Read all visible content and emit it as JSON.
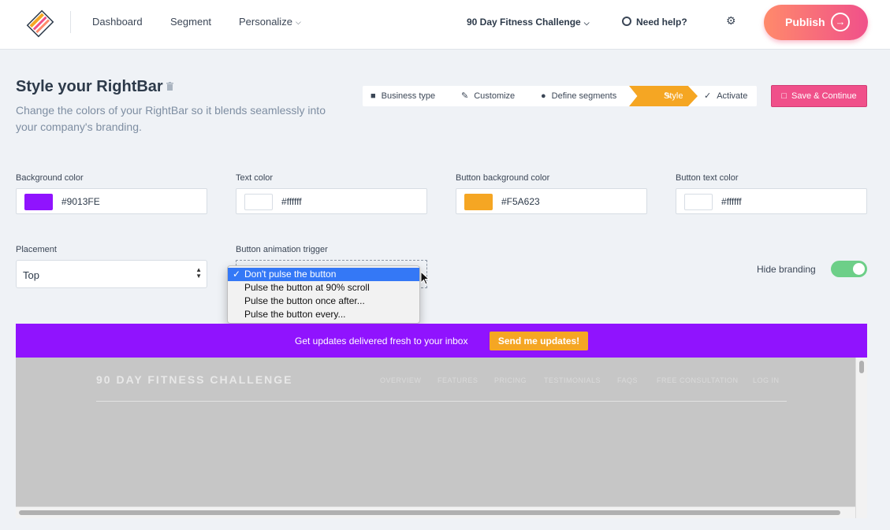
{
  "nav": {
    "links": [
      "Dashboard",
      "Segment",
      "Personalize"
    ],
    "personalize_chevron": "chevron-down-icon",
    "project": "90 Day Fitness Challenge",
    "help": "Need help?",
    "publish": "Publish"
  },
  "header": {
    "title": "Style your RightBar",
    "subtitle": "Change the colors of your RightBar so it blends seamlessly into your company's branding."
  },
  "stepper": {
    "steps": [
      "Business type",
      "Customize",
      "Define segments",
      "Style",
      "Activate"
    ],
    "active": "Style",
    "save": "Save & Continue"
  },
  "colors": [
    {
      "label": "Background color",
      "value": "#9013FE",
      "swatch": "#9013FE"
    },
    {
      "label": "Text color",
      "value": "#ffffff",
      "swatch": "#ffffff"
    },
    {
      "label": "Button background color",
      "value": "#F5A623",
      "swatch": "#F5A623"
    },
    {
      "label": "Button text color",
      "value": "#ffffff",
      "swatch": "#ffffff"
    }
  ],
  "placement": {
    "label": "Placement",
    "value": "Top"
  },
  "animation": {
    "label": "Button animation trigger",
    "options": [
      "Don't pulse the button",
      "Pulse the button at 90% scroll",
      "Pulse the button once after...",
      "Pulse the button every..."
    ],
    "selected": "Don't pulse the button"
  },
  "branding": {
    "label": "Hide branding",
    "enabled": true
  },
  "bar": {
    "message": "Get updates delivered fresh to your inbox",
    "button": "Send me updates!",
    "background": "#9013FE",
    "button_color": "#F5A623"
  },
  "preview": {
    "site_title": "90 DAY FITNESS CHALLENGE",
    "nav": [
      "OVERVIEW",
      "FEATURES",
      "PRICING",
      "TESTIMONIALS",
      "FAQS",
      "FREE CONSULTATION",
      "LOG IN"
    ]
  }
}
